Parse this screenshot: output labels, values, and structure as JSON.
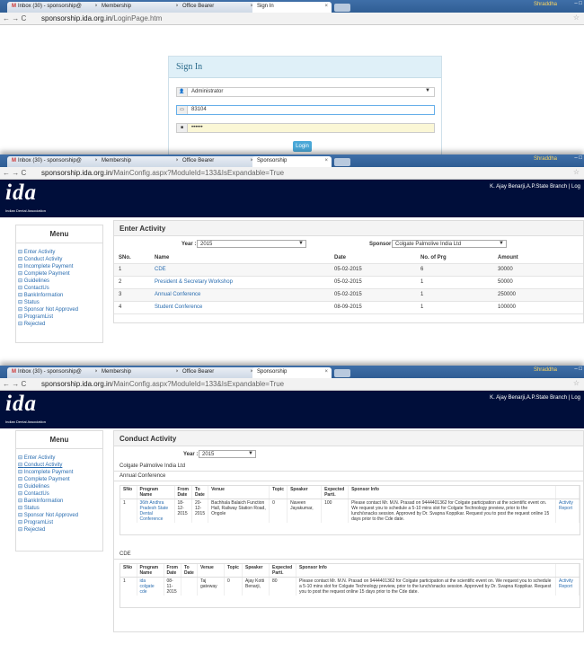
{
  "s1": {
    "tabs": [
      "Inbox (30) - sponsorship@",
      "Membership",
      "Office Bearer",
      "Sign In"
    ],
    "user": "Shraddha",
    "url_host": "sponsorship.ida.org.in",
    "url_path": "/LoginPage.htm",
    "title": "Sign In",
    "role": "Administrator",
    "username": "83104",
    "password": "••••••",
    "login": "Login"
  },
  "s2": {
    "tabs": [
      "Inbox (30) - sponsorship@",
      "Membership",
      "Office Bearer",
      "Sponsorship"
    ],
    "user": "Shraddha",
    "url_host": "sponsorship.ida.org.in",
    "url_path": "/MainConfig.aspx?ModuleId=133&IsExpandable=True",
    "logo": "ida",
    "logo_sub": "Indian Dental Association",
    "branch": "K. Ajay Benarji,A.P.State Branch | Log",
    "menu_title": "Menu",
    "menu": [
      "Enter Activity",
      "Conduct Activity",
      "Incomplete Payment",
      "Complete Payment",
      "Guidelines",
      "ContactUs",
      "BankInformation",
      "Status",
      "Sponsor Not Approved",
      "ProgramList",
      "Rejected"
    ],
    "panel_title": "Enter Activity",
    "year_label": "Year :",
    "year": "2015",
    "sponsor_label": "Sponsor :",
    "sponsor": "Colgate Palmolive India Ltd",
    "cols": [
      "SNo.",
      "Name",
      "Date",
      "No. of Prg",
      "Amount"
    ],
    "rows": [
      [
        "1",
        "CDE",
        "05-02-2015",
        "6",
        "30000"
      ],
      [
        "2",
        "President & Secretary Workshop",
        "05-02-2015",
        "1",
        "50000"
      ],
      [
        "3",
        "Annual Conference",
        "05-02-2015",
        "1",
        "250000"
      ],
      [
        "4",
        "Student Conference",
        "08-09-2015",
        "1",
        "100000"
      ]
    ]
  },
  "s3": {
    "tabs": [
      "Inbox (30) - sponsorship@",
      "Membership",
      "Office Bearer",
      "Sponsorship"
    ],
    "user": "Shraddha",
    "url_host": "sponsorship.ida.org.in",
    "url_path": "/MainConfig.aspx?ModuleId=133&IsExpandable=True",
    "branch": "K. Ajay Benarji,A.P.State Branch | Log",
    "menu_title": "Menu",
    "panel_title": "Conduct Activity",
    "year_label": "Year :",
    "year": "2015",
    "org": "Colgate Palmolive India Ltd",
    "t1": {
      "label": "Annual Conference",
      "cols": [
        "SNo",
        "Program Name",
        "From Date",
        "To Date",
        "Venue",
        "Topic",
        "Speaker",
        "Expected Parti.",
        "Sponsor Info",
        ""
      ],
      "row": [
        "1",
        "36th Andhra Pradesh State Dental Conference",
        "18-12-2015",
        "20-12-2015",
        "Bachhala Balaich Function Hall, Railway Station Road, Ongole",
        "0",
        "Naveen Jayakumar,",
        "100",
        "Please contact Mr. M.N. Prasad on 9444401362 for Colgate participation at the scientific event on. We request you to schedule a 5-10 mins slot for Colgate Technology preview, prior to the lunch/snacks session. Approved by Dr. Svapna Koppikar. Request you to post the request online 15 days prior to the Cde date.",
        "Activity Report"
      ]
    },
    "t2": {
      "label": "CDE",
      "cols": [
        "SNo",
        "Program Name",
        "From Date",
        "To Date",
        "Venue",
        "Topic",
        "Speaker",
        "Expected Parti.",
        "Sponsor Info",
        ""
      ],
      "row": [
        "1",
        "ida colgate cde",
        "08-11-2015",
        "",
        "Taj gateway",
        "0",
        "Ajay Kotti Benarji,",
        "80",
        "Please contact Mr. M.N. Prasad on 9444401362 for Colgate participation at the scientific event on. We request you to schedule a 5-10 mins slot for Colgate Technology preview, prior to the lunch/snacks session. Approved by Dr. Svapna Koppikar. Request you to post the request online 15 days prior to the Cde date.",
        "Activity Report"
      ]
    }
  }
}
